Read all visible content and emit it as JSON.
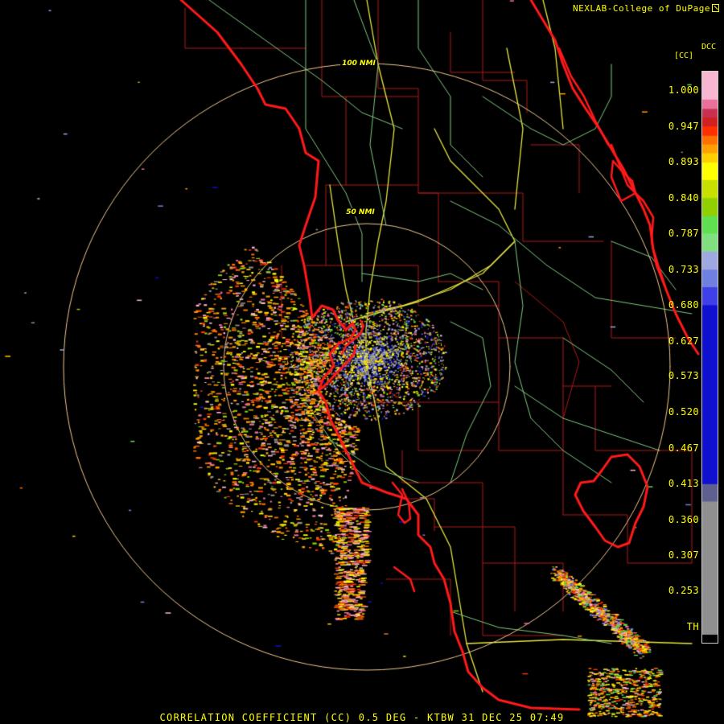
{
  "header": {
    "credit": "NEXLAB-College of DuPage",
    "credit_icon": "external-link-icon",
    "product_code": "DCC",
    "unit_label": "[CC]"
  },
  "legend": {
    "ticks": [
      "1.000",
      "0.947",
      "0.893",
      "0.840",
      "0.787",
      "0.733",
      "0.680",
      "0.627",
      "0.573",
      "0.520",
      "0.467",
      "0.413",
      "0.360",
      "0.307",
      "0.253",
      "TH"
    ],
    "colors": [
      {
        "from": 1.0,
        "to": 0.987,
        "color": "#f7b7d0"
      },
      {
        "from": 0.987,
        "to": 0.973,
        "color": "#e8709a"
      },
      {
        "from": 0.973,
        "to": 0.96,
        "color": "#c83050"
      },
      {
        "from": 0.96,
        "to": 0.947,
        "color": "#d02020"
      },
      {
        "from": 0.947,
        "to": 0.933,
        "color": "#ff3000"
      },
      {
        "from": 0.933,
        "to": 0.92,
        "color": "#ff7000"
      },
      {
        "from": 0.92,
        "to": 0.907,
        "color": "#ffa000"
      },
      {
        "from": 0.907,
        "to": 0.893,
        "color": "#ffd000"
      },
      {
        "from": 0.893,
        "to": 0.867,
        "color": "#ffff00"
      },
      {
        "from": 0.867,
        "to": 0.84,
        "color": "#c8e000"
      },
      {
        "from": 0.84,
        "to": 0.813,
        "color": "#90d000"
      },
      {
        "from": 0.813,
        "to": 0.787,
        "color": "#60e050"
      },
      {
        "from": 0.787,
        "to": 0.76,
        "color": "#80e080"
      },
      {
        "from": 0.76,
        "to": 0.733,
        "color": "#a0a8e0"
      },
      {
        "from": 0.733,
        "to": 0.707,
        "color": "#7080e0"
      },
      {
        "from": 0.707,
        "to": 0.68,
        "color": "#4040e8"
      },
      {
        "from": 0.68,
        "to": 0.413,
        "color": "#1010d0"
      },
      {
        "from": 0.413,
        "to": 0.387,
        "color": "#606090"
      },
      {
        "from": 0.387,
        "to": 0.2,
        "color": "#909090"
      }
    ]
  },
  "rings": [
    {
      "label": "100 NMI",
      "radius_nmi": 100
    },
    {
      "label": "50 NMI",
      "radius_nmi": 50
    }
  ],
  "caption": "CORRELATION COEFFICIENT (CC) 0.5 DEG - KTBW 31 DEC 25 07:49",
  "colors": {
    "coast": "#ff1a1a",
    "county": "#b01818",
    "highway_major": "#e6e640",
    "highway_minor": "#80c880",
    "range_ring": "#f0c890",
    "text": "#ffff00"
  }
}
